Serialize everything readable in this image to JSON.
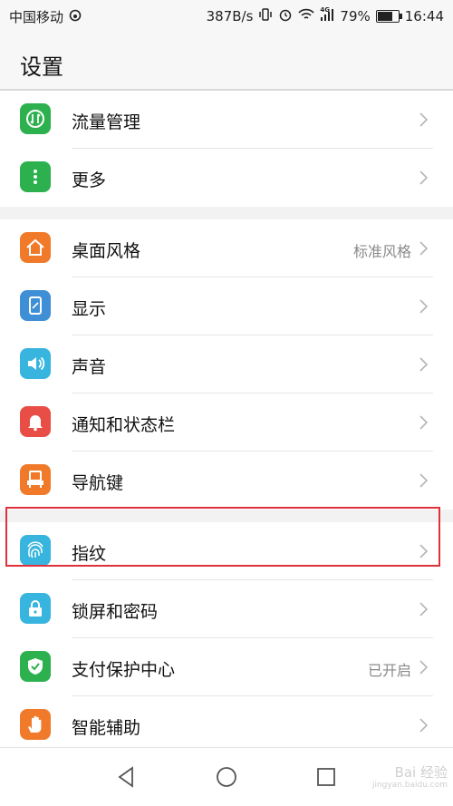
{
  "status_bar": {
    "carrier": "中国移动",
    "speed": "387B/s",
    "signal_badge": "4G",
    "battery": "79%",
    "battery_level": 0.79,
    "time": "16:44"
  },
  "header": {
    "title": "设置"
  },
  "groups": [
    [
      {
        "label": "流量管理",
        "value": "",
        "icon": "traffic-icon",
        "color": "#2db14e"
      },
      {
        "label": "更多",
        "value": "",
        "icon": "more-icon",
        "color": "#2db14e"
      }
    ],
    [
      {
        "label": "桌面风格",
        "value": "标准风格",
        "icon": "home-icon",
        "color": "#f07a2a"
      },
      {
        "label": "显示",
        "value": "",
        "icon": "display-icon",
        "color": "#3f8fd6"
      },
      {
        "label": "声音",
        "value": "",
        "icon": "sound-icon",
        "color": "#38b5de"
      },
      {
        "label": "通知和状态栏",
        "value": "",
        "icon": "bell-icon",
        "color": "#e94e46"
      },
      {
        "label": "导航键",
        "value": "",
        "icon": "nav-key-icon",
        "color": "#f07a2a"
      }
    ],
    [
      {
        "label": "指纹",
        "value": "",
        "icon": "fingerprint-icon",
        "color": "#38b5de"
      },
      {
        "label": "锁屏和密码",
        "value": "",
        "icon": "lock-icon",
        "color": "#38b5de"
      },
      {
        "label": "支付保护中心",
        "value": "已开启",
        "icon": "shield-icon",
        "color": "#2db14e"
      },
      {
        "label": "智能辅助",
        "value": "",
        "icon": "hand-icon",
        "color": "#f07a2a"
      }
    ]
  ],
  "watermark": {
    "line1": "Bai 经验",
    "line2": "jingyan.baidu.com"
  }
}
